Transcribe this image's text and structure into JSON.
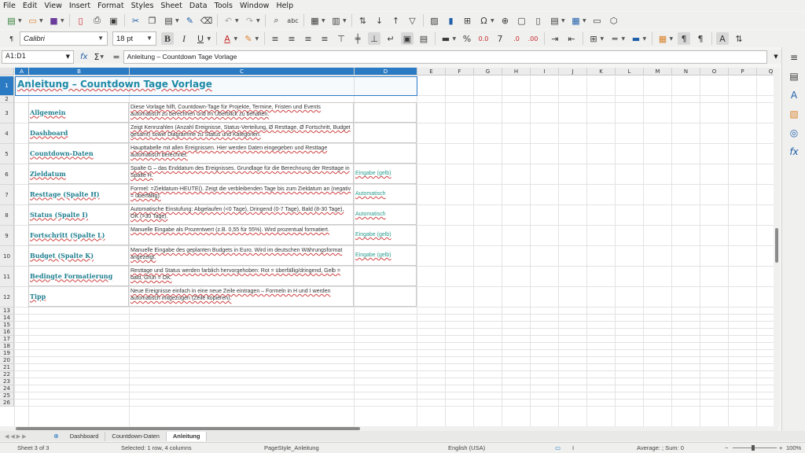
{
  "menu": [
    "File",
    "Edit",
    "View",
    "Insert",
    "Format",
    "Styles",
    "Sheet",
    "Data",
    "Tools",
    "Window",
    "Help"
  ],
  "font_name": "Calibri",
  "font_size": "18 pt",
  "name_box": "A1:D1",
  "formula_value": "Anleitung – Countdown Tage Vorlage",
  "columns": [
    "A",
    "B",
    "C",
    "D",
    "E",
    "F",
    "G",
    "H",
    "I",
    "J",
    "K",
    "L",
    "M",
    "N",
    "O",
    "P",
    "Q"
  ],
  "rows": [
    "1",
    "2",
    "3",
    "4",
    "5",
    "6",
    "7",
    "8",
    "9",
    "10",
    "11",
    "12",
    "13",
    "14",
    "15",
    "16",
    "17",
    "18",
    "19",
    "20",
    "21",
    "22",
    "23",
    "24",
    "25",
    "26"
  ],
  "title": "Anleitung – Countdown Tage Vorlage",
  "table": [
    {
      "label": "Allgemein",
      "desc": "Diese Vorlage hilft, Countdown-Tage für Projekte, Termine, Fristen und Events automatisch zu berechnen und im Überblick zu behalten.",
      "hint": ""
    },
    {
      "label": "Dashboard",
      "desc": "Zeigt Kennzahlen (Anzahl Ereignisse, Status-Verteilung, Ø Resttage, Ø Fortschritt, Budget gesamt) sowie Diagramme zu Status und Kategorien.",
      "hint": ""
    },
    {
      "label": "Countdown-Daten",
      "desc": "Haupttabelle mit allen Ereignissen. Hier werden Daten eingegeben und Resttage automatisch berechnet.",
      "hint": ""
    },
    {
      "label": "Zieldatum",
      "desc": "Spalte G – das Enddatum des Ereignisses. Grundlage für die Berechnung der Resttage in Spalte H.",
      "hint": "Eingabe (gelb)"
    },
    {
      "label": "Resttage (Spalte H)",
      "desc": "Formel: =Zieldatum-HEUTE(). Zeigt die verbleibenden Tage bis zum Zieldatum an (negativ = überfällig).",
      "hint": "Automatisch"
    },
    {
      "label": "Status (Spalte I)",
      "desc": "Automatische Einstufung: Abgelaufen (<0 Tage), Dringend (0-7 Tage), Bald (8-30 Tage), OK (>30 Tage).",
      "hint": "Automatisch"
    },
    {
      "label": "Fortschritt (Spalte L)",
      "desc": "Manuelle Eingabe als Prozentwert (z.B. 0,55 für 55%). Wird prozentual formatiert.",
      "hint": "Eingabe (gelb)"
    },
    {
      "label": "Budget (Spalte K)",
      "desc": "Manuelle Eingabe des geplanten Budgets in Euro. Wird im deutschen Währungsformat angezeigt.",
      "hint": "Eingabe (gelb)"
    },
    {
      "label": "Bedingte Formatierung",
      "desc": "Resttage und Status werden farblich hervorgehoben: Rot = überfällig/dringend, Gelb = bald, Grün = OK.",
      "hint": ""
    },
    {
      "label": "Tipp",
      "desc": "Neue Ereignisse einfach in eine neue Zeile eintragen – Formeln in H und I werden automatisch mitgezogen (Zeile kopieren).",
      "hint": ""
    }
  ],
  "tabs": [
    "Dashboard",
    "Countdown-Daten",
    "Anleitung"
  ],
  "active_tab": "Anleitung",
  "status": {
    "sheet": "Sheet 3 of 3",
    "selection": "Selected: 1 row, 4 columns",
    "page_style": "PageStyle_Anleitung",
    "language": "English (USA)",
    "summary": "Average: ; Sum: 0",
    "zoom": "100%"
  },
  "icons": [
    "new-icon",
    "open-icon",
    "save-icon",
    "export-pdf-icon",
    "print-icon",
    "print-preview-icon",
    "cut-icon",
    "copy-icon",
    "paste-icon",
    "clone-formatting-icon",
    "clear-formatting-icon",
    "undo-icon",
    "redo-icon",
    "find-replace-icon",
    "spellcheck-icon",
    "row-icon",
    "column-icon",
    "sort-icon",
    "sort-ascending-icon",
    "sort-descending-icon",
    "autofilter-icon",
    "image-icon",
    "chart-icon",
    "pivot-table-icon",
    "special-character-icon",
    "hyperlink-icon",
    "comment-icon",
    "headers-footers-icon",
    "define-print-area-icon",
    "freeze-rows-columns-icon",
    "split-window-icon",
    "show-draw-functions-icon"
  ]
}
